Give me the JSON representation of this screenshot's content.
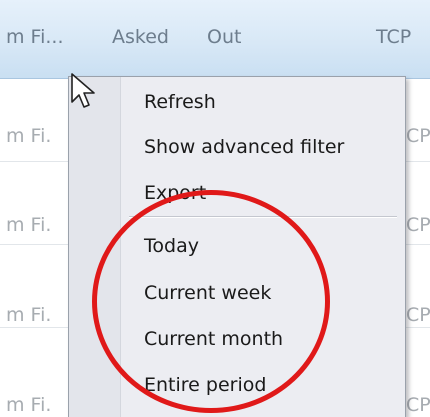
{
  "grid": {
    "columns": [
      "m Fi...",
      "Asked",
      "Out",
      "TCP"
    ],
    "rows": [
      {
        "col1": "m Fi.",
        "col4": "CP"
      },
      {
        "col1": "m Fi.",
        "col4": "CP"
      },
      {
        "col1": "m Fi.",
        "col4": "CP"
      },
      {
        "col1": "m Fi.",
        "col4": "CP"
      }
    ]
  },
  "context_menu": {
    "items": [
      "Refresh",
      "Show advanced filter",
      "Export",
      "Today",
      "Current week",
      "Current month",
      "Entire period"
    ]
  },
  "annotation": {
    "highlight_color": "#e01919"
  }
}
